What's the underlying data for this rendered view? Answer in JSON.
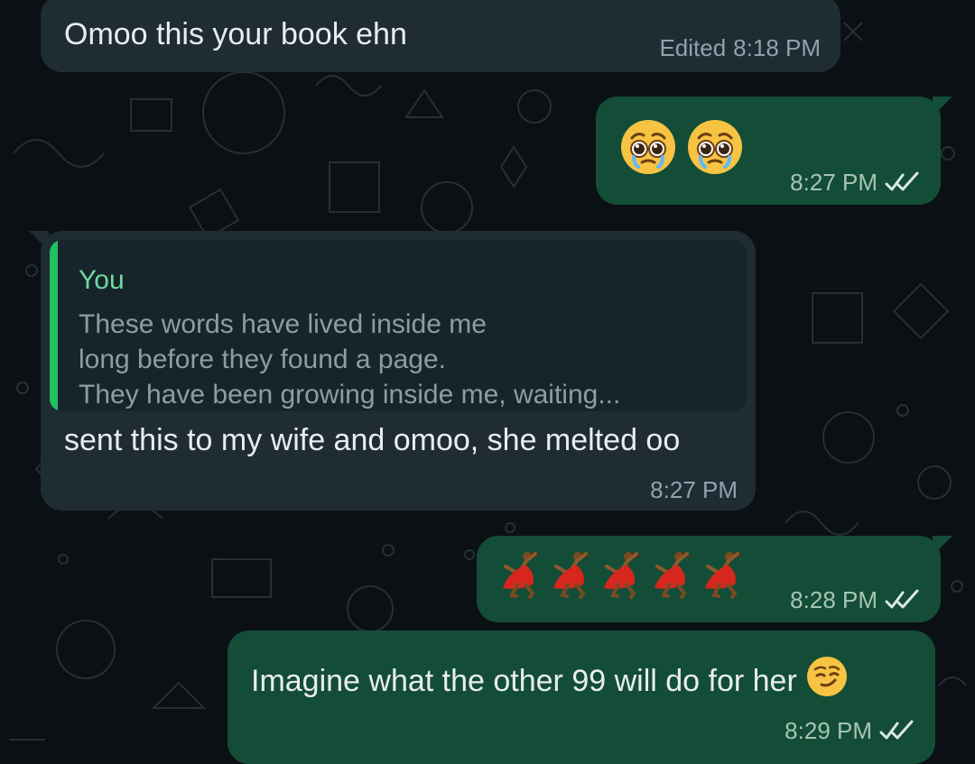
{
  "colors": {
    "background": "#0b1014",
    "incoming_bubble": "#1f2c33",
    "outgoing_bubble": "#144d37",
    "quote_background": "#18242b",
    "quote_accent": "#21c063",
    "quote_author": "#6fd9a2",
    "read_ticks": "#dbe8e3"
  },
  "messages": [
    {
      "direction": "incoming",
      "text": "Omoo this your book ehn",
      "edited_label": "Edited",
      "time": "8:18 PM"
    },
    {
      "direction": "outgoing",
      "emojis": [
        "pleading-face-emoji",
        "pleading-face-emoji"
      ],
      "time": "8:27 PM",
      "status_icon": "double-check-icon"
    },
    {
      "direction": "incoming",
      "quote": {
        "author": "You",
        "lines": [
          "These words have lived inside me",
          "long before they found a page.",
          "They have been growing inside me, waiting..."
        ]
      },
      "text": "sent this to my wife and omoo, she melted oo",
      "time": "8:27 PM"
    },
    {
      "direction": "outgoing",
      "emojis": [
        "dancing-woman-emoji",
        "dancing-woman-emoji",
        "dancing-woman-emoji",
        "dancing-woman-emoji",
        "dancing-woman-emoji"
      ],
      "time": "8:28 PM",
      "status_icon": "double-check-icon"
    },
    {
      "direction": "outgoing",
      "text": "Imagine what the other 99 will do for her",
      "emoji": "smirking-face-emoji",
      "time": "8:29 PM",
      "status_icon": "double-check-icon"
    }
  ]
}
